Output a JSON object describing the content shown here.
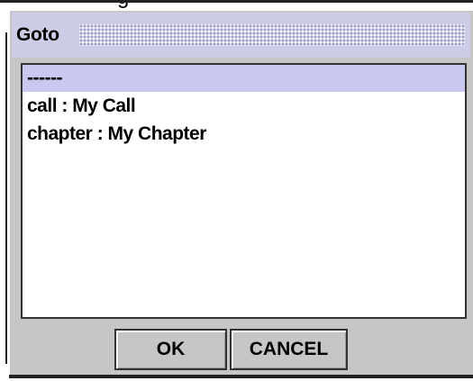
{
  "window": {
    "top_fragment": "g",
    "title": "Goto"
  },
  "list": {
    "items": [
      {
        "label": "------",
        "selected": true
      },
      {
        "label": "call : My Call",
        "selected": false
      },
      {
        "label": "chapter : My Chapter",
        "selected": false
      }
    ]
  },
  "buttons": {
    "ok_label": "OK",
    "cancel_label": "CANCEL"
  },
  "colors": {
    "titlebar": "#cccce6",
    "selection": "#c8c8f0",
    "panel": "#c6c6c6"
  }
}
